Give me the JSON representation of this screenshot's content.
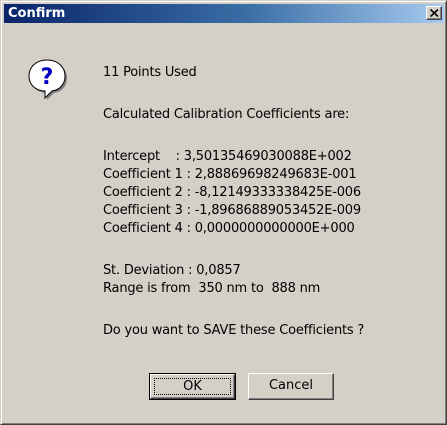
{
  "window": {
    "title": "Confirm",
    "close_icon": "close-icon"
  },
  "dialog": {
    "icon": "question-icon",
    "points_used": "11 Points Used",
    "calc_header": "Calculated Calibration Coefficients are:",
    "coefficients": [
      "Intercept    : 3,50135469030088E+002",
      "Coefficient 1 : 2,88869698249683E-001",
      "Coefficient 2 : -8,12149333338425E-006",
      "Coefficient 3 : -1,89686889053452E-009",
      "Coefficient 4 : 0,0000000000000E+000"
    ],
    "std_deviation": "St. Deviation : 0,0857",
    "range": "Range is from  350 nm to  888 nm",
    "question": "Do you want to SAVE these Coefficients ?"
  },
  "buttons": {
    "ok_label": "OK",
    "cancel_label": "Cancel"
  }
}
